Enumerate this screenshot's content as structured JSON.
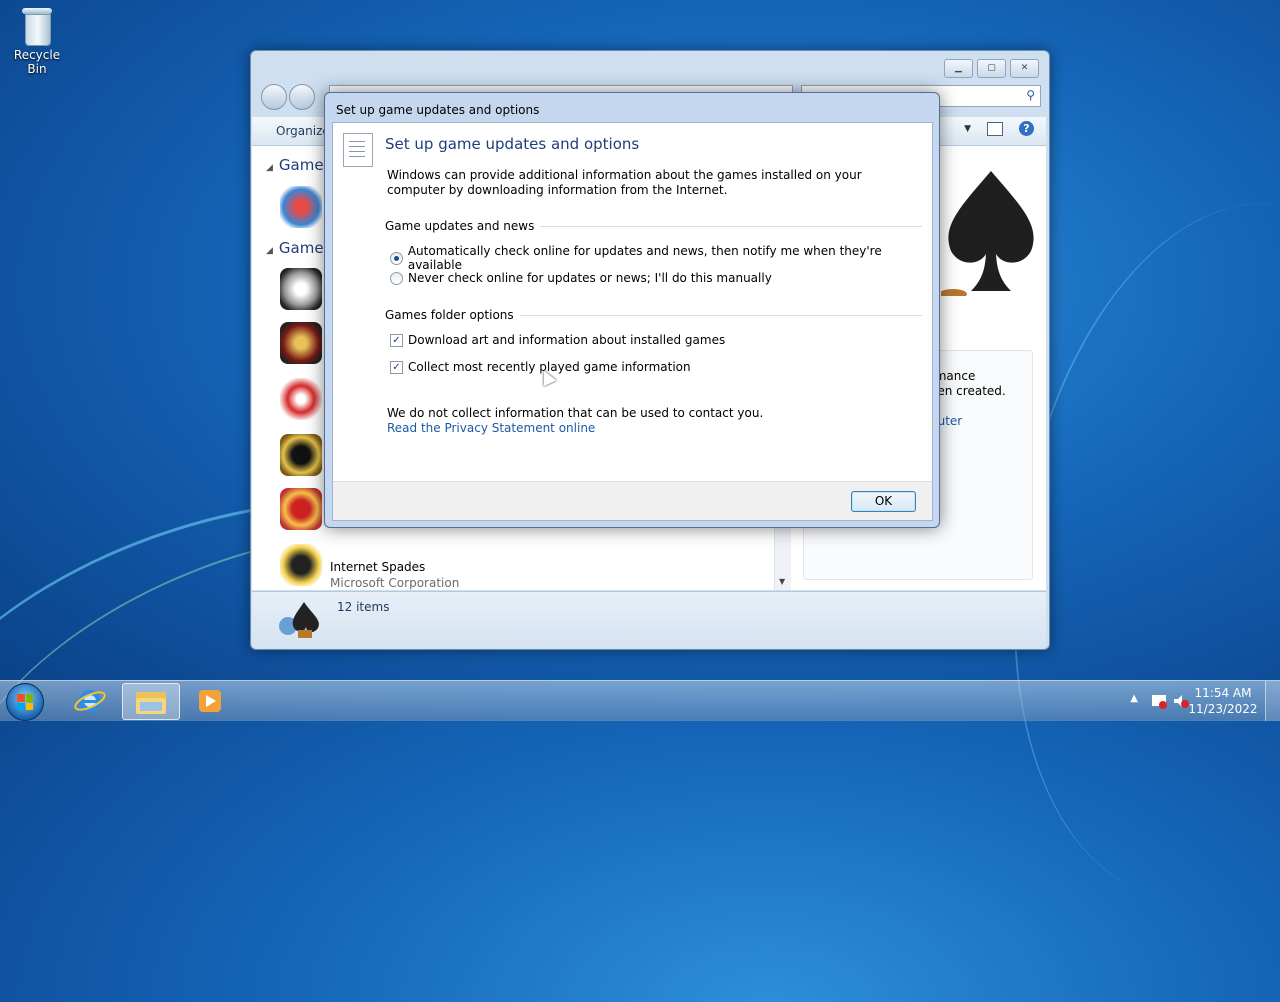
{
  "desktop": {
    "recycle_bin_label": "Recycle Bin"
  },
  "explorer": {
    "toolbar": {
      "organize_label": "Organize"
    },
    "groups": {
      "game_updates_label": "Game U",
      "games_label": "Games"
    },
    "visible_item": {
      "title": "Internet Spades",
      "publisher": "Microsoft Corporation"
    },
    "preview": {
      "line1": "rmance",
      "line2": "een created.",
      "link1": "puter",
      "link2": "e"
    },
    "status": {
      "count": "12 items"
    }
  },
  "dialog": {
    "window_title": "Set up game updates and options",
    "heading": "Set up game updates and options",
    "description": "Windows can provide additional information about the games installed on your computer by downloading information from the Internet.",
    "section1": "Game updates and news",
    "radio_auto": "Automatically check online for updates and news, then notify me when they're available",
    "radio_never": "Never check online for updates or news; I'll do this manually",
    "section2": "Games folder options",
    "check_download": "Download art and information about installed games",
    "check_collect": "Collect most recently played game information",
    "note": "We do not collect information that can be used to contact you.",
    "privacy_link": "Read the Privacy Statement online",
    "ok_label": "OK",
    "radio_auto_selected": true,
    "check_download_checked": true,
    "check_collect_checked": true
  },
  "taskbar": {
    "time": "11:54 AM",
    "date": "11/23/2022"
  },
  "colors": {
    "heading": "#1e3f7a",
    "link": "#1c5aa6"
  }
}
